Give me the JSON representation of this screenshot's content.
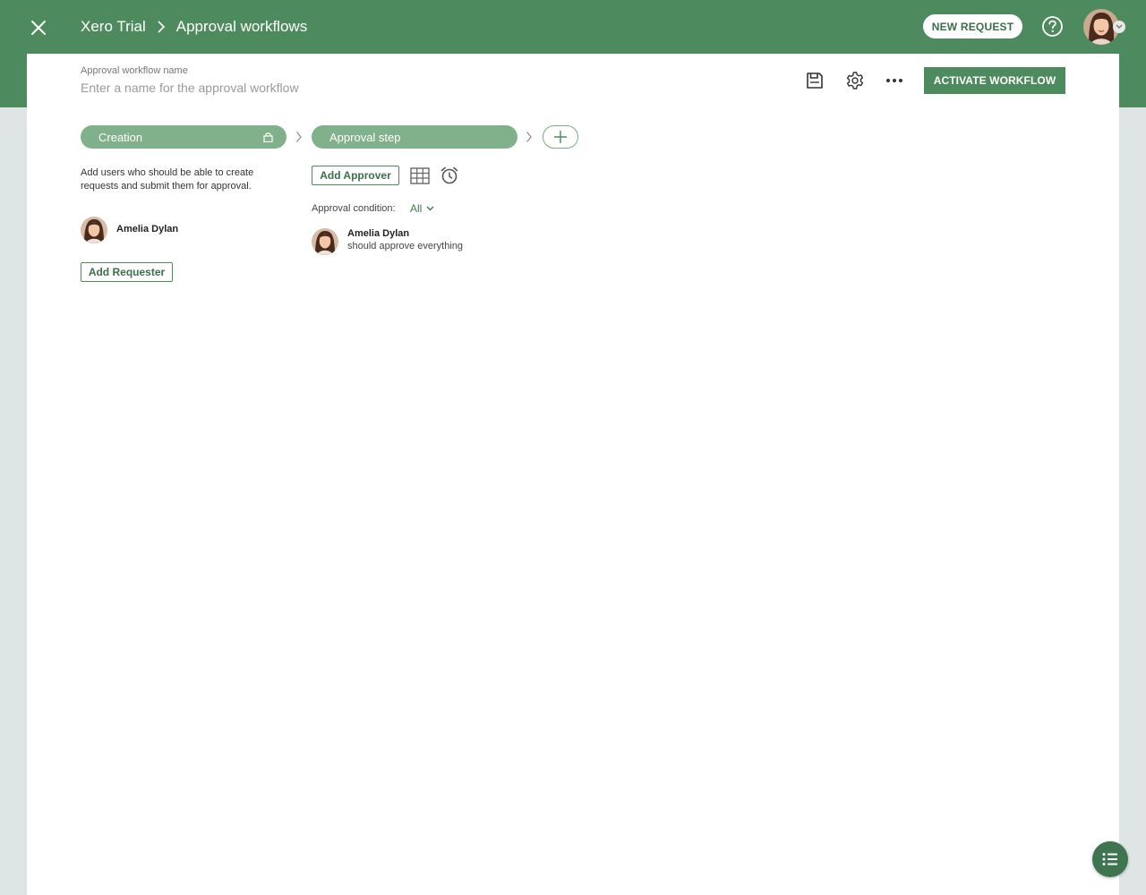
{
  "header": {
    "breadcrumb_org": "Xero Trial",
    "breadcrumb_page": "Approval workflows",
    "new_request_label": "NEW REQUEST",
    "close_icon": "close-icon",
    "help_icon": "help-circle-icon"
  },
  "workflow": {
    "name_label": "Approval workflow name",
    "name_value": "",
    "name_placeholder": "Enter a name for the approval workflow",
    "activate_label": "ACTIVATE WORKFLOW",
    "toolbar_icons": [
      "save-icon",
      "gear-icon",
      "more-icon"
    ]
  },
  "steps": [
    {
      "label": "Creation",
      "locked": true
    },
    {
      "label": "Approval step",
      "locked": false
    }
  ],
  "creation": {
    "help_text": "Add users who should be able to create requests and submit them for approval.",
    "requester_name": "Amelia Dylan",
    "add_requester_label": "Add Requester"
  },
  "approval": {
    "add_approver_label": "Add Approver",
    "condition_label": "Approval condition:",
    "condition_value": "All",
    "approver_name": "Amelia Dylan",
    "approver_note": "should approve everything"
  },
  "colors": {
    "brand_green": "#4d8b5f",
    "pill_green": "#80b18a",
    "background": "#dfe4e5"
  }
}
